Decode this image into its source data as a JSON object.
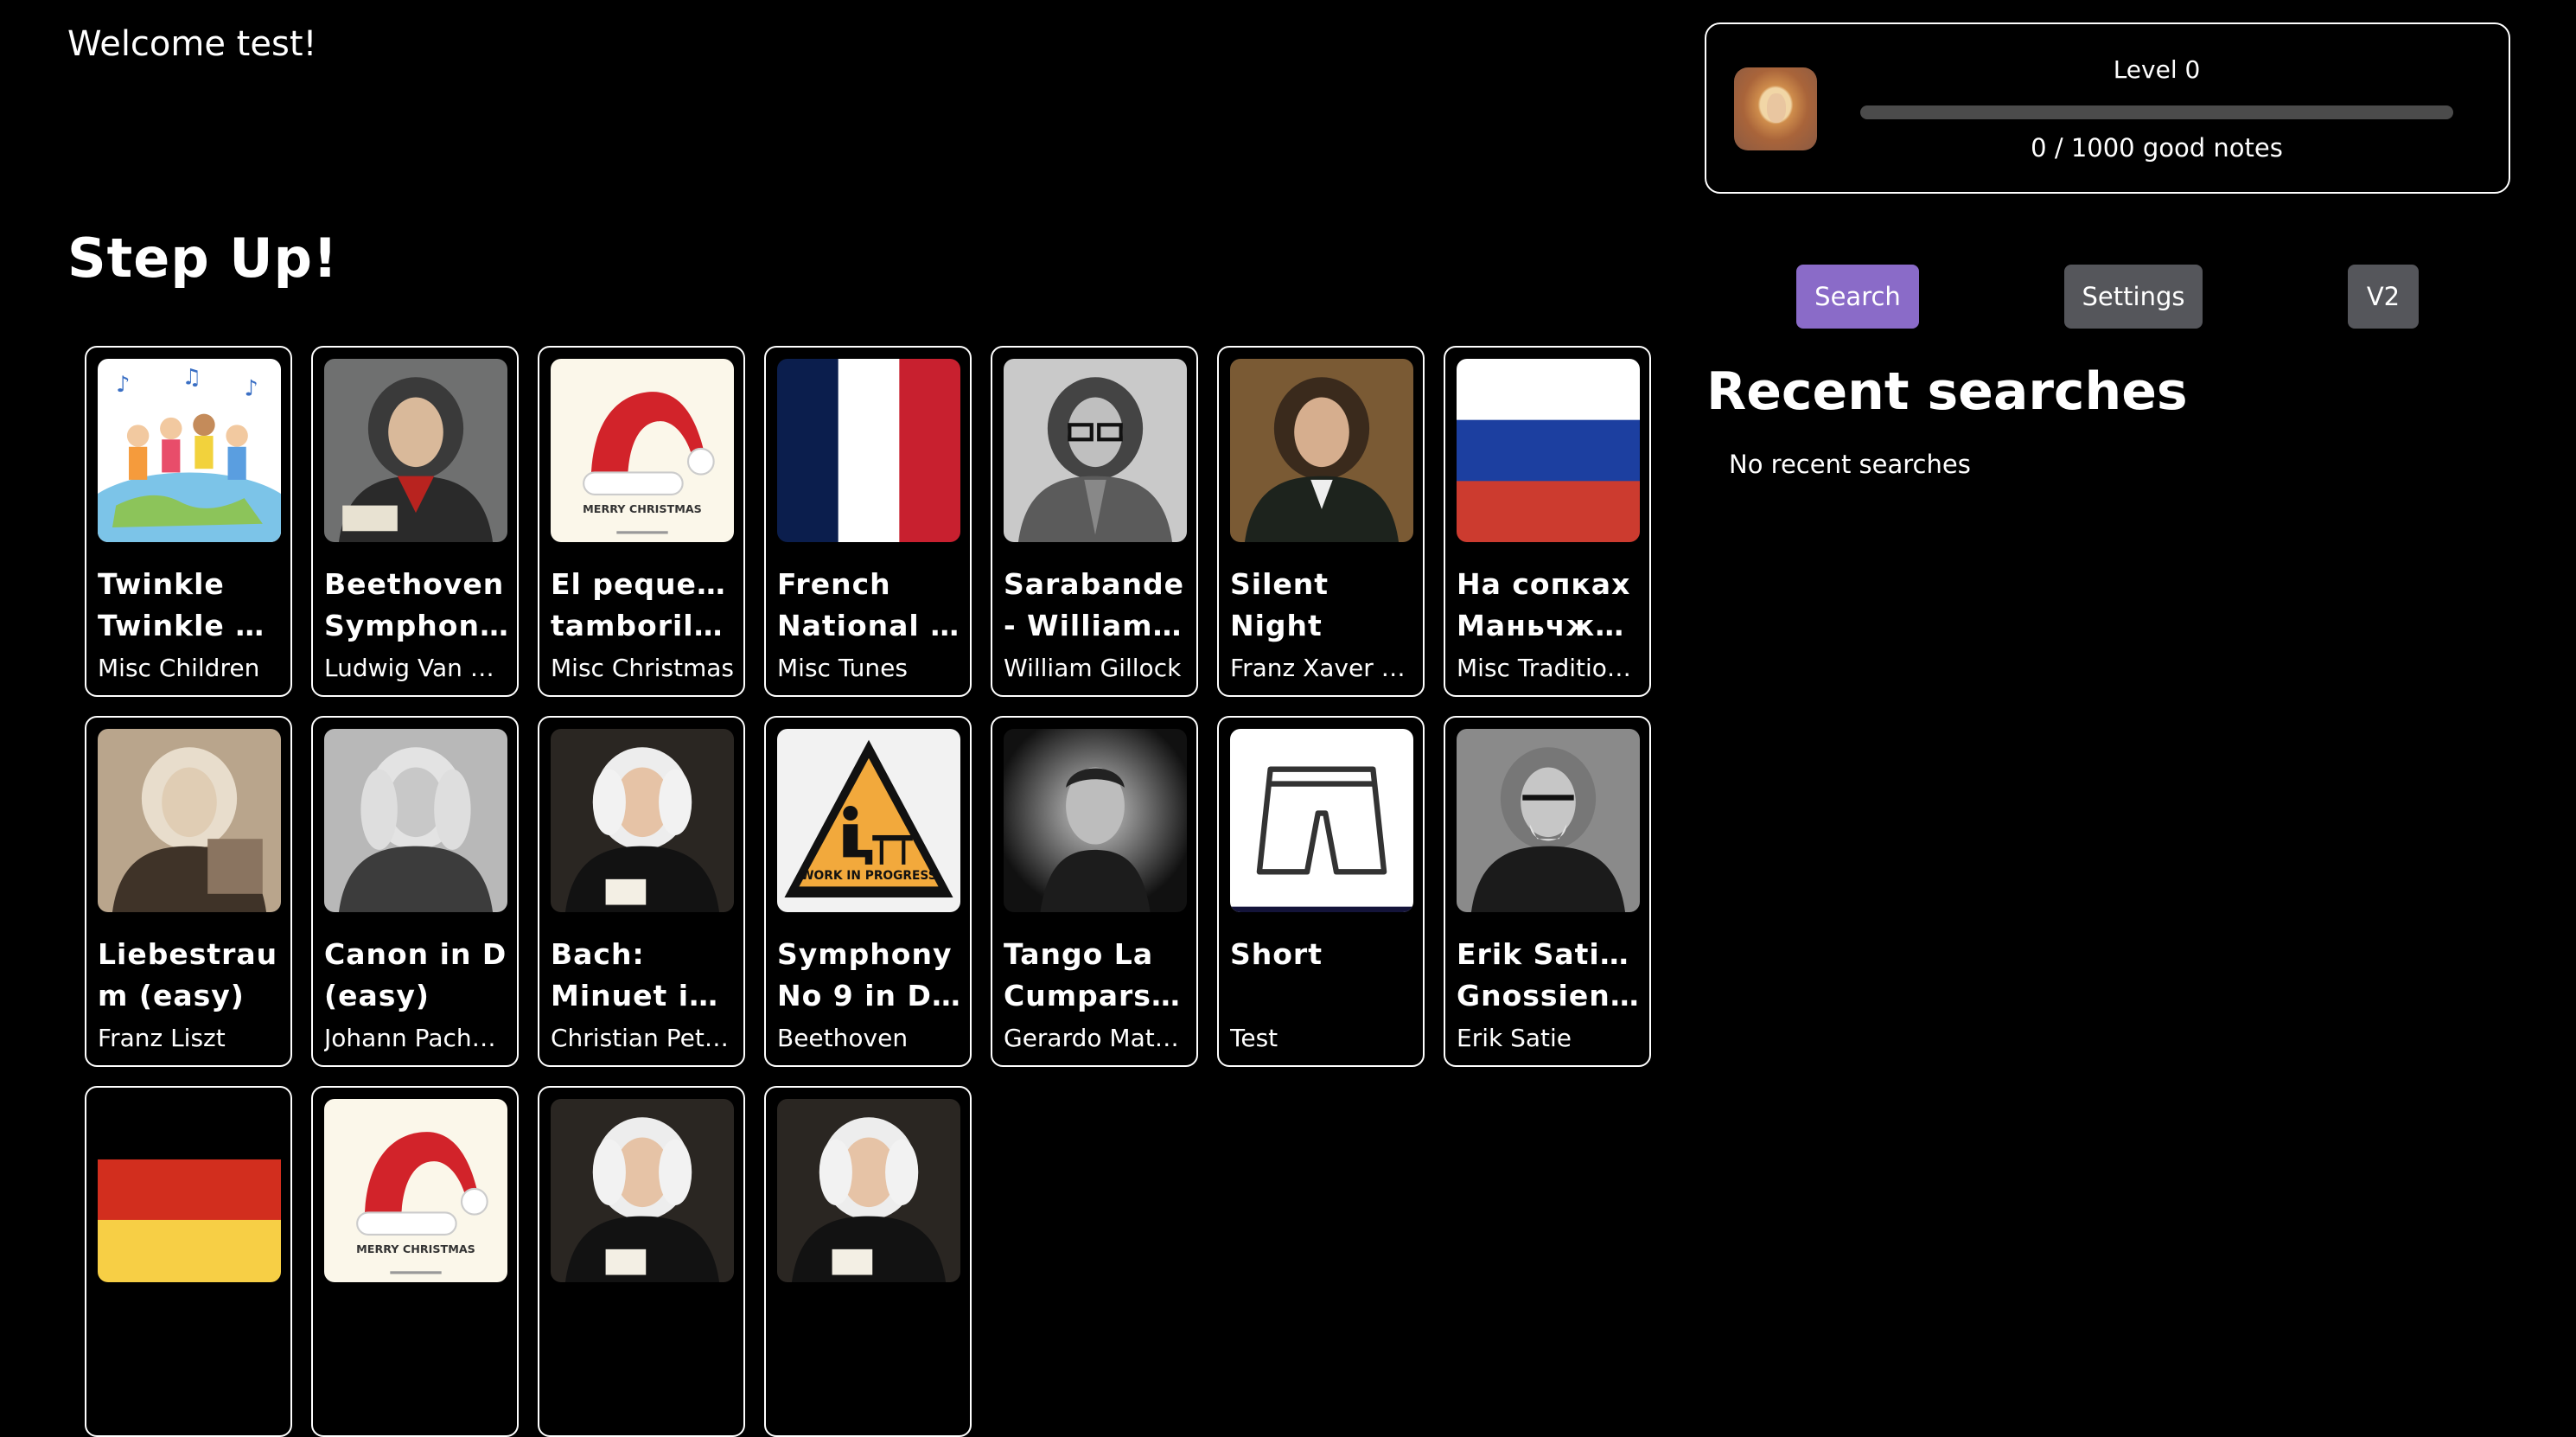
{
  "header": {
    "welcome": "Welcome test!"
  },
  "section_title": "Step Up!",
  "level": {
    "label": "Level 0",
    "notes_text": "0 / 1000 good notes",
    "progress": 0
  },
  "nav": {
    "search": "Search",
    "settings": "Settings",
    "v2": "V2"
  },
  "recent": {
    "title": "Recent searches",
    "empty": "No recent searches"
  },
  "colors": {
    "accent": "#8a6bc8",
    "button_gray": "#55565b",
    "bar_track": "#4b4b4b"
  },
  "songs": [
    {
      "title_lines": [
        "Twinkle",
        "Twinkle …"
      ],
      "artist": "Misc Children",
      "art": "kids-globe-icon"
    },
    {
      "title_lines": [
        "Beethoven",
        "Symphon…"
      ],
      "artist": "Ludwig Van B…",
      "art": "beethoven-portrait-icon"
    },
    {
      "title_lines": [
        "El pequeño",
        "tamborile…"
      ],
      "artist": "Misc Christmas",
      "art": "santa-hat-icon",
      "art_text": "MERRY CHRISTMAS"
    },
    {
      "title_lines": [
        "French",
        "National …"
      ],
      "artist": "Misc Tunes",
      "art": "france-flag-icon"
    },
    {
      "title_lines": [
        "Sarabande",
        "- William …"
      ],
      "artist": "William Gillock",
      "art": "gillock-portrait-icon"
    },
    {
      "title_lines": [
        "Silent",
        "Night"
      ],
      "artist": "Franz Xaver G…",
      "art": "gruber-portrait-icon"
    },
    {
      "title_lines": [
        "На сопках",
        "Маньчжури…"
      ],
      "artist": "Misc Traditional",
      "art": "russia-flag-icon"
    },
    {
      "title_lines": [
        "Liebestrau",
        "m (easy)"
      ],
      "artist": "Franz Liszt",
      "art": "liszt-portrait-icon"
    },
    {
      "title_lines": [
        "Canon in D",
        "(easy)"
      ],
      "artist": "Johann Pache…",
      "art": "pachelbel-portrait-icon"
    },
    {
      "title_lines": [
        "Bach:",
        "Minuet in …"
      ],
      "artist": "Christian Petz…",
      "art": "bach-portrait-icon"
    },
    {
      "title_lines": [
        "Symphony",
        "No 9 in D …"
      ],
      "artist": "Beethoven",
      "art": "work-in-progress-icon",
      "art_text": "WORK IN PROGRESS"
    },
    {
      "title_lines": [
        "Tango La",
        "Cumparsit…"
      ],
      "artist": "Gerardo Mato…",
      "art": "matos-portrait-icon"
    },
    {
      "title_lines": [
        "Short",
        ""
      ],
      "artist": "Test",
      "art": "shorts-icon"
    },
    {
      "title_lines": [
        "Erik Satie -",
        "Gnossienn…"
      ],
      "artist": "Erik Satie",
      "art": "satie-portrait-icon"
    },
    {
      "title_lines": [
        "",
        ""
      ],
      "artist": "",
      "art": "germany-flag-icon"
    },
    {
      "title_lines": [
        "",
        ""
      ],
      "artist": "",
      "art": "santa-hat-icon",
      "art_text": "MERRY CHRISTMAS"
    },
    {
      "title_lines": [
        "",
        ""
      ],
      "artist": "",
      "art": "bach-portrait-icon"
    },
    {
      "title_lines": [
        "",
        ""
      ],
      "artist": "",
      "art": "bach-portrait-icon"
    }
  ]
}
